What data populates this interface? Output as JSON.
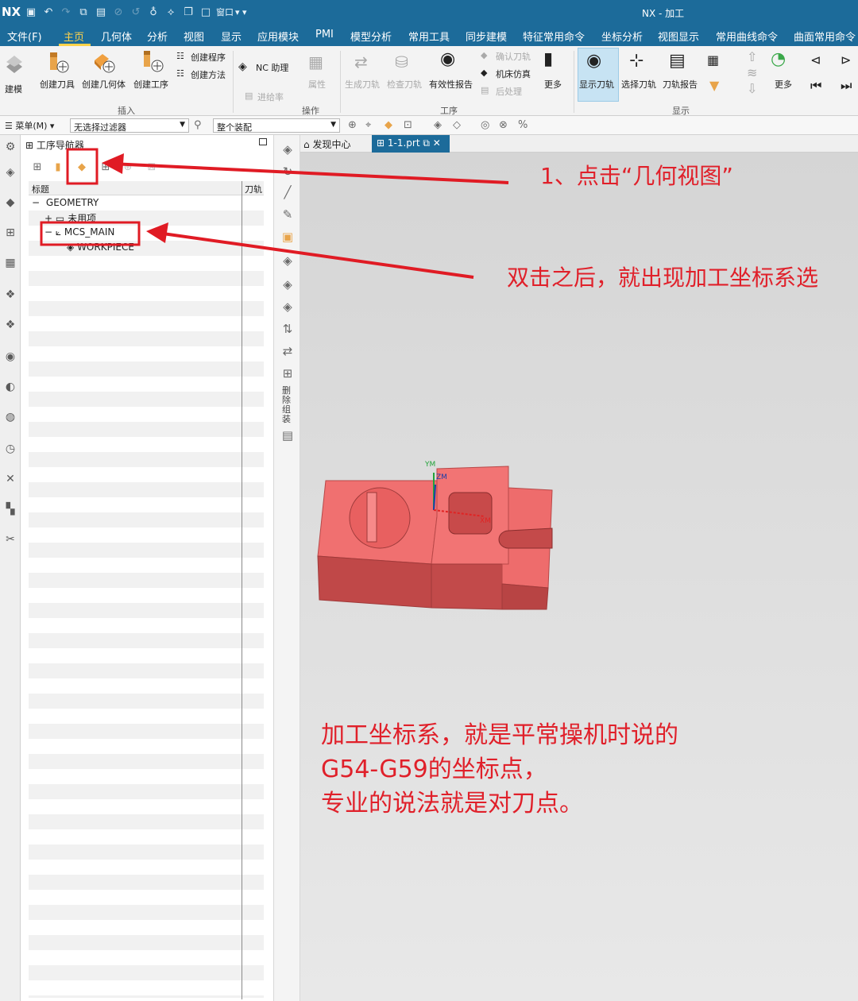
{
  "window": {
    "logo": "NX",
    "title": "NX - 加工",
    "quick_access_window": "窗口"
  },
  "menu_tabs": [
    "文件(F)",
    "主页",
    "几何体",
    "分析",
    "视图",
    "显示",
    "应用模块",
    "PMI",
    "模型分析",
    "常用工具",
    "同步建模",
    "特征常用命令",
    "坐标分析",
    "视图显示",
    "常用曲线命令",
    "曲面常用命令"
  ],
  "active_tab": "主页",
  "ribbon": {
    "jianmo": "建模",
    "create_tool": "创建刀具",
    "create_geometry": "创建几何体",
    "create_operation": "创建工序",
    "create_program": "创建程序",
    "create_method": "创建方法",
    "nc_helper": "NC 助理",
    "feed_rate": "进给率",
    "attributes": "属性",
    "generate_path": "生成刀轨",
    "check_tool": "检查刀轨",
    "validity_report": "有效性报告",
    "confirm_path": "确认刀轨",
    "machine_sim": "机床仿真",
    "post_process": "后处理",
    "more1": "更多",
    "show_path": "显示刀轨",
    "select_path": "选择刀轨",
    "path_report": "刀轨报告",
    "more2": "更多",
    "group_insert": "插入",
    "group_ops": "操作",
    "group_process": "工序",
    "group_display": "显示"
  },
  "toolbar": {
    "menu": "菜单(M)",
    "filter": "无选择过滤器",
    "assembly": "整个装配"
  },
  "navigator": {
    "title": "工序导航器",
    "col_title": "标题",
    "col_path": "刀轨",
    "rows": [
      "GEOMETRY",
      "未用项",
      "MCS_MAIN",
      "WORKPIECE"
    ]
  },
  "vertical_bar": {
    "label": "删除组装"
  },
  "doc_tabs": [
    "发现中心",
    "1-1.prt"
  ],
  "viewport": {
    "axis_y": "YM",
    "axis_z": "ZM",
    "axis_x": "XM",
    "part_color": "#f06a6a"
  },
  "annotations": {
    "step1": "1、点击“几何视图”",
    "step2": "双击之后，就出现加工坐标系选",
    "note_line1": "加工坐标系，就是平常操机时说的",
    "note_line2": "G54-G59的坐标点，",
    "note_line3": "专业的说法就是对刀点。"
  },
  "colors": {
    "title_bar": "#1c6b9a",
    "active_tab": "#ffd24a",
    "annotation_red": "#e0202a"
  }
}
